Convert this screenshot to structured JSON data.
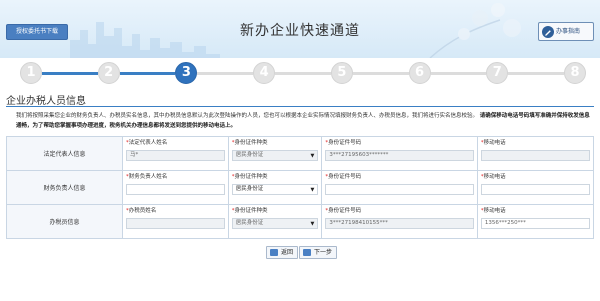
{
  "header": {
    "auth_button": "授权委托书下载",
    "title": "新办企业快速通道",
    "guide_button": "办事指南"
  },
  "steps": [
    "1",
    "2",
    "3",
    "4",
    "5",
    "6",
    "7",
    "8"
  ],
  "active_step": 3,
  "section": {
    "title": "企业办税人员信息",
    "notice_plain": "我们将按照采集您企业的财务负责人、办税员实名信息，其中办税员信息默认为此次登陆操作的人员，您也可以根据本企业实际情况填报财务负责人、办税员信息，我们将进行实名信息校验。",
    "notice_bold": "请确保移动电话号码填写准确并保持收发信息通畅，为了帮助您掌握事项办理进度，税务机关办理信息都将发送到您提供的移动电话上。"
  },
  "rows": [
    {
      "label": "法定代表人信息",
      "fields": [
        {
          "label": "法定代表人姓名",
          "value": "马*",
          "kind": "input-gray"
        },
        {
          "label": "身份证件种类",
          "value": "居民身份证",
          "kind": "select-gray"
        },
        {
          "label": "身份证件号码",
          "value": "3***27195603*******",
          "kind": "input-gray"
        },
        {
          "label": "移动电话",
          "value": "",
          "kind": "input-gray"
        }
      ]
    },
    {
      "label": "财务负责人信息",
      "fields": [
        {
          "label": "财务负责人姓名",
          "value": "",
          "kind": "input-white"
        },
        {
          "label": "身份证件种类",
          "value": "居民身份证",
          "kind": "select-white"
        },
        {
          "label": "身份证件号码",
          "value": "",
          "kind": "input-white"
        },
        {
          "label": "移动电话",
          "value": "",
          "kind": "input-white"
        }
      ]
    },
    {
      "label": "办税员信息",
      "fields": [
        {
          "label": "办税员姓名",
          "value": "",
          "kind": "input-gray"
        },
        {
          "label": "身份证件种类",
          "value": "居民身份证",
          "kind": "select-gray"
        },
        {
          "label": "身份证件号码",
          "value": "3***27198410155***",
          "kind": "input-gray"
        },
        {
          "label": "移动电话",
          "value": "1356***250***",
          "kind": "input-white"
        }
      ]
    }
  ],
  "buttons": {
    "back": "返回",
    "next": "下一步"
  },
  "colors": {
    "accent": "#2f72bd",
    "required": "#e02020",
    "step_inactive": "#e3e3e3"
  }
}
